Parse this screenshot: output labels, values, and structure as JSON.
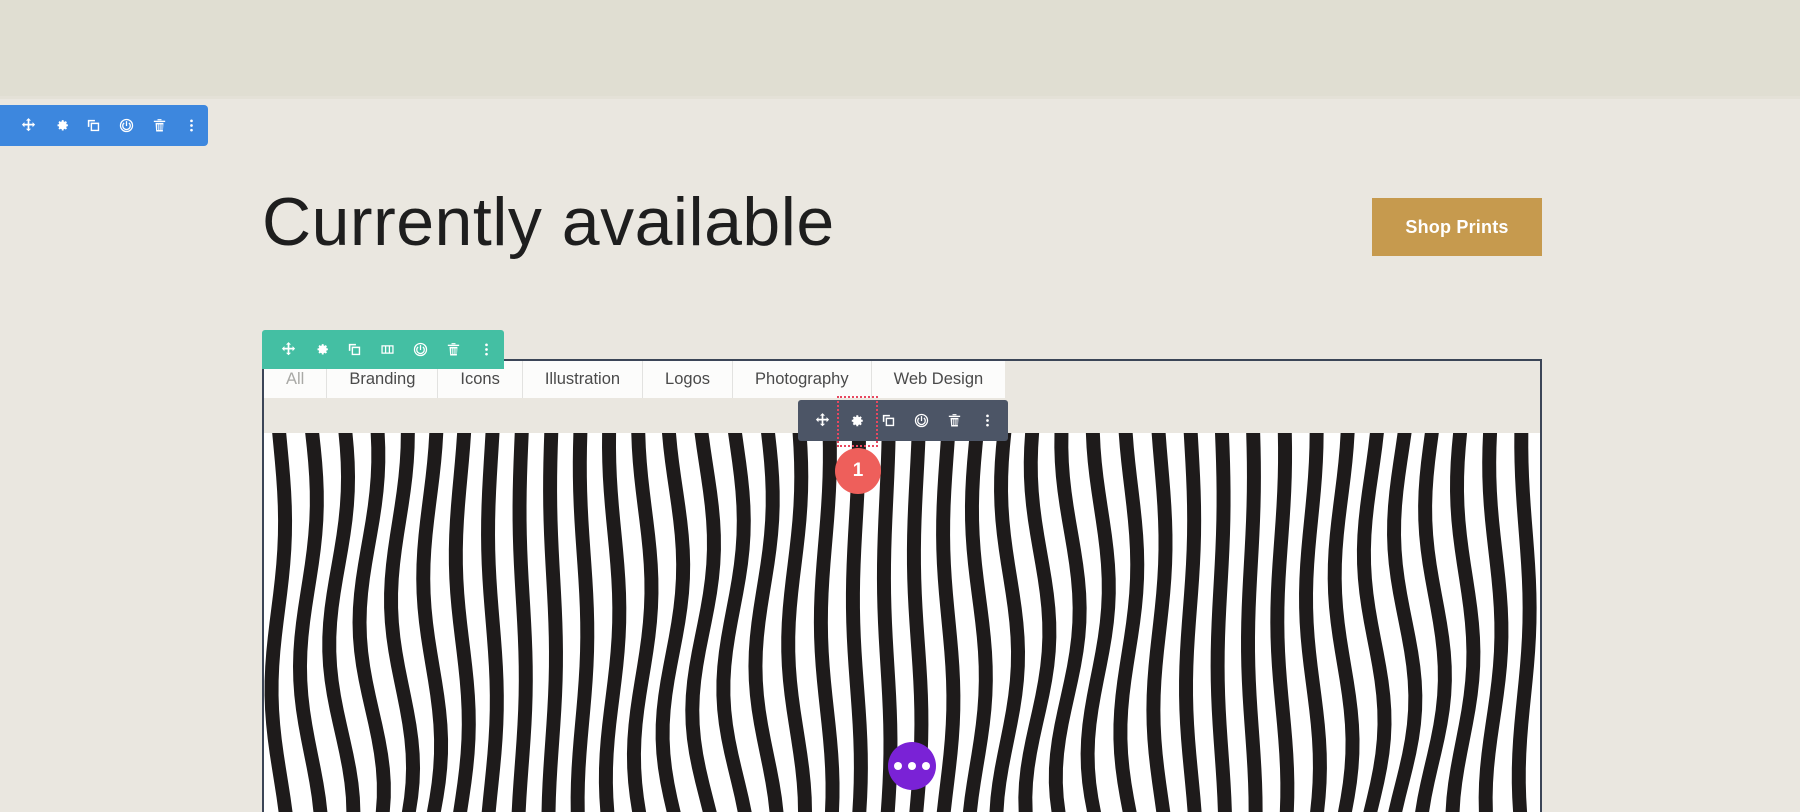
{
  "page": {
    "title": "Currently available",
    "background_top": "#E0DED2",
    "background_main": "#EAE7E0"
  },
  "shop_button": {
    "label": "Shop Prints",
    "color": "#C69A4E"
  },
  "toolbars": {
    "section": {
      "name": "section-toolbar",
      "color": "#3D87DE",
      "buttons": [
        {
          "icon": "move-icon",
          "label": "Move"
        },
        {
          "icon": "gear-icon",
          "label": "Settings"
        },
        {
          "icon": "duplicate-icon",
          "label": "Duplicate"
        },
        {
          "icon": "power-icon",
          "label": "Disable"
        },
        {
          "icon": "trash-icon",
          "label": "Delete"
        },
        {
          "icon": "kebab-menu-icon",
          "label": "More Options"
        }
      ]
    },
    "row": {
      "name": "row-toolbar",
      "color": "#44BFA3",
      "buttons": [
        {
          "icon": "move-icon",
          "label": "Move"
        },
        {
          "icon": "gear-icon",
          "label": "Settings"
        },
        {
          "icon": "duplicate-icon",
          "label": "Duplicate"
        },
        {
          "icon": "columns-icon",
          "label": "Column Structure"
        },
        {
          "icon": "power-icon",
          "label": "Disable"
        },
        {
          "icon": "trash-icon",
          "label": "Delete"
        },
        {
          "icon": "kebab-menu-icon",
          "label": "More Options"
        }
      ]
    },
    "module": {
      "name": "module-toolbar",
      "color": "#4C5566",
      "highlighted_index": 1,
      "buttons": [
        {
          "icon": "move-icon",
          "label": "Move"
        },
        {
          "icon": "gear-icon",
          "label": "Settings"
        },
        {
          "icon": "duplicate-icon",
          "label": "Duplicate"
        },
        {
          "icon": "power-icon",
          "label": "Disable"
        },
        {
          "icon": "trash-icon",
          "label": "Delete"
        },
        {
          "icon": "kebab-menu-icon",
          "label": "More Options"
        }
      ]
    }
  },
  "filter_tabs": {
    "active": "All",
    "items": [
      {
        "label": "All"
      },
      {
        "label": "Branding"
      },
      {
        "label": "Icons"
      },
      {
        "label": "Illustration"
      },
      {
        "label": "Logos"
      },
      {
        "label": "Photography"
      },
      {
        "label": "Web Design"
      }
    ]
  },
  "badges": {
    "count": {
      "value": "1",
      "color": "#EE5F5B"
    },
    "more": {
      "icon": "ellipsis-icon",
      "color": "#7A22D6"
    }
  },
  "gallery_image": {
    "description": "Black and white wavy vertical stripe pattern",
    "stripe_color": "#1E1B1B",
    "background_color": "#FFFFFF",
    "stripe_count": 42
  }
}
